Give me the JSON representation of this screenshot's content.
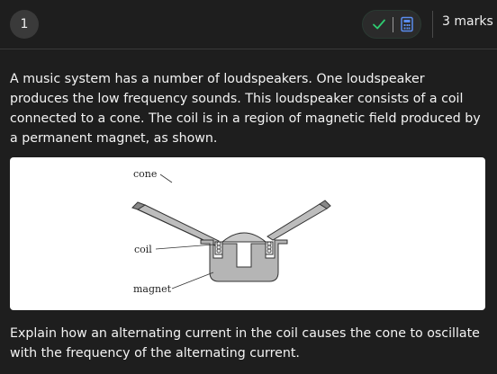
{
  "header": {
    "question_number": "1",
    "marks": "3 marks",
    "icons": [
      "check-icon",
      "calculator-icon"
    ]
  },
  "question": {
    "intro": "A music system has a number of loudspeakers. One loudspeaker produces the low frequency sounds. This loudspeaker consists of a coil connected to a cone. The coil is in a region of magnetic field produced by a permanent magnet, as shown.",
    "prompt": "Explain how an alternating current in the coil causes the cone to oscillate with the frequency of the alternating current."
  },
  "figure": {
    "labels": {
      "cone": "cone",
      "coil": "coil",
      "magnet": "magnet"
    }
  },
  "colors": {
    "background": "#1e1e1e",
    "accent_green": "#2ecc71"
  }
}
